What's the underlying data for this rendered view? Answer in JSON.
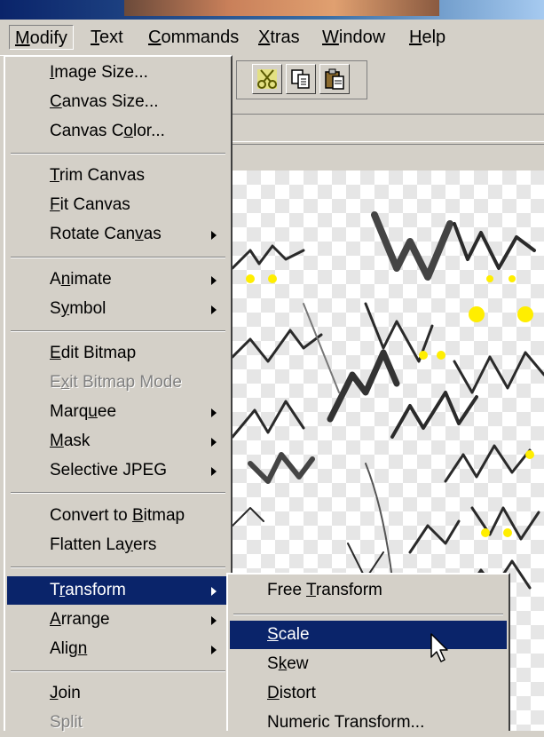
{
  "menubar": {
    "items": [
      {
        "label": "Modify",
        "mnemonic": "M"
      },
      {
        "label": "Text",
        "mnemonic": "T"
      },
      {
        "label": "Commands",
        "mnemonic": "C"
      },
      {
        "label": "Xtras",
        "mnemonic": "X"
      },
      {
        "label": "Window",
        "mnemonic": "W"
      },
      {
        "label": "Help",
        "mnemonic": "H"
      }
    ]
  },
  "modify_menu": {
    "items": [
      {
        "label": "Image Size...",
        "submenu": false,
        "enabled": true
      },
      {
        "label": "Canvas Size...",
        "submenu": false,
        "enabled": true
      },
      {
        "label": "Canvas Color...",
        "submenu": false,
        "enabled": true
      },
      {
        "label": "Trim Canvas",
        "submenu": false,
        "enabled": true
      },
      {
        "label": "Fit Canvas",
        "submenu": false,
        "enabled": true
      },
      {
        "label": "Rotate Canvas",
        "submenu": true,
        "enabled": true
      },
      {
        "label": "Animate",
        "submenu": true,
        "enabled": true
      },
      {
        "label": "Symbol",
        "submenu": true,
        "enabled": true
      },
      {
        "label": "Edit Bitmap",
        "submenu": false,
        "enabled": true
      },
      {
        "label": "Exit Bitmap Mode",
        "submenu": false,
        "enabled": false
      },
      {
        "label": "Marquee",
        "submenu": true,
        "enabled": true
      },
      {
        "label": "Mask",
        "submenu": true,
        "enabled": true
      },
      {
        "label": "Selective JPEG",
        "submenu": true,
        "enabled": true
      },
      {
        "label": "Convert to Bitmap",
        "submenu": false,
        "enabled": true
      },
      {
        "label": "Flatten Layers",
        "submenu": false,
        "enabled": true
      },
      {
        "label": "Transform",
        "submenu": true,
        "enabled": true,
        "highlighted": true
      },
      {
        "label": "Arrange",
        "submenu": true,
        "enabled": true
      },
      {
        "label": "Align",
        "submenu": true,
        "enabled": true
      },
      {
        "label": "Join",
        "submenu": false,
        "enabled": true
      },
      {
        "label": "Split",
        "submenu": false,
        "enabled": false
      }
    ]
  },
  "transform_submenu": {
    "items": [
      {
        "label": "Free Transform",
        "enabled": true
      },
      {
        "label": "Scale",
        "enabled": true,
        "highlighted": true
      },
      {
        "label": "Skew",
        "enabled": true
      },
      {
        "label": "Distort",
        "enabled": true
      },
      {
        "label": "Numeric Transform...",
        "enabled": true
      }
    ]
  },
  "toolbar": {
    "buttons": [
      {
        "icon": "cut-icon"
      },
      {
        "icon": "copy-icon"
      },
      {
        "icon": "paste-icon"
      }
    ]
  },
  "colors": {
    "menu_bg": "#d4d0c8",
    "highlight": "#0a246a",
    "highlight_text": "#ffffff",
    "disabled_text": "#808080"
  }
}
